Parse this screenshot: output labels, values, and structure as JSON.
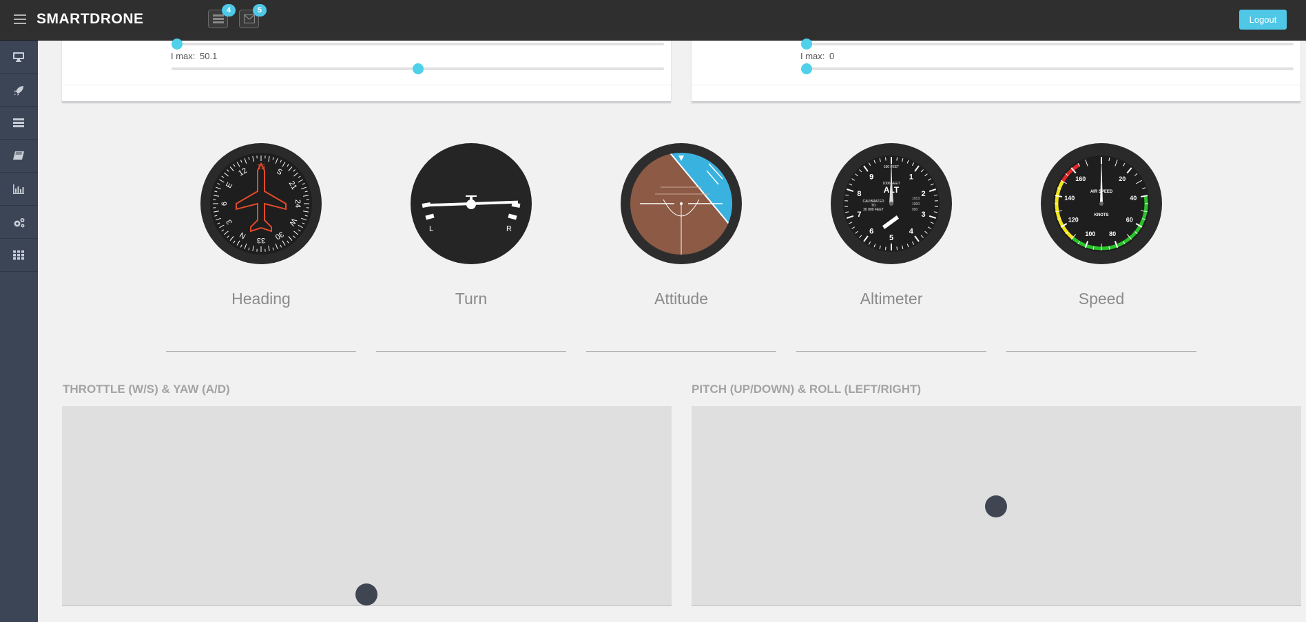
{
  "app": {
    "brand": "SMARTDRONE",
    "logout_label": "Logout",
    "accent_color": "#4fc7e6"
  },
  "header": {
    "notifications": [
      {
        "icon": "tasks-icon",
        "count": "4"
      },
      {
        "icon": "envelope-icon",
        "count": "5"
      }
    ]
  },
  "sidebar": {
    "items": [
      {
        "icon": "desktop-icon"
      },
      {
        "icon": "rocket-icon"
      },
      {
        "icon": "server-icon"
      },
      {
        "icon": "book-icon"
      },
      {
        "icon": "bar-chart-icon"
      },
      {
        "icon": "cogs-icon"
      },
      {
        "icon": "grid-icon"
      }
    ]
  },
  "pid_panels": [
    {
      "i_max_label": "I max:",
      "i_max_value": "50.1",
      "slider_fraction": 0.5
    },
    {
      "i_max_label": "I max:",
      "i_max_value": "0",
      "slider_fraction": 0.0
    }
  ],
  "gauges": [
    {
      "label": "Heading"
    },
    {
      "label": "Turn"
    },
    {
      "label": "Attitude"
    },
    {
      "label": "Altimeter"
    },
    {
      "label": "Speed"
    }
  ],
  "heading_gauge": {
    "marks": [
      "15",
      "S",
      "21",
      "24",
      "W",
      "30",
      "33",
      "N",
      "3",
      "6",
      "E",
      "12"
    ]
  },
  "turn_gauge": {
    "left": "L",
    "right": "R"
  },
  "altimeter_gauge": {
    "numbers": [
      "1",
      "2",
      "3",
      "4",
      "5",
      "6",
      "7",
      "8",
      "9"
    ],
    "top_text": "100 FEET",
    "mid_text": "1000 FEET",
    "title": "ALT",
    "cal_text": "CALIBRATED",
    "cal_to": "TO",
    "cal_feet": "20 000 FEET",
    "baro": [
      "1013",
      "1000",
      "990"
    ]
  },
  "speed_gauge": {
    "numbers": [
      "20",
      "40",
      "60",
      "80",
      "100",
      "120",
      "140",
      "160"
    ],
    "title": "AIR SPEED",
    "unit": "KNOTS"
  },
  "controls": {
    "throttle_title": "THROTTLE (W/S) & YAW (A/D)",
    "pitch_title": "PITCH (UP/DOWN) & ROLL (LEFT/RIGHT)"
  }
}
